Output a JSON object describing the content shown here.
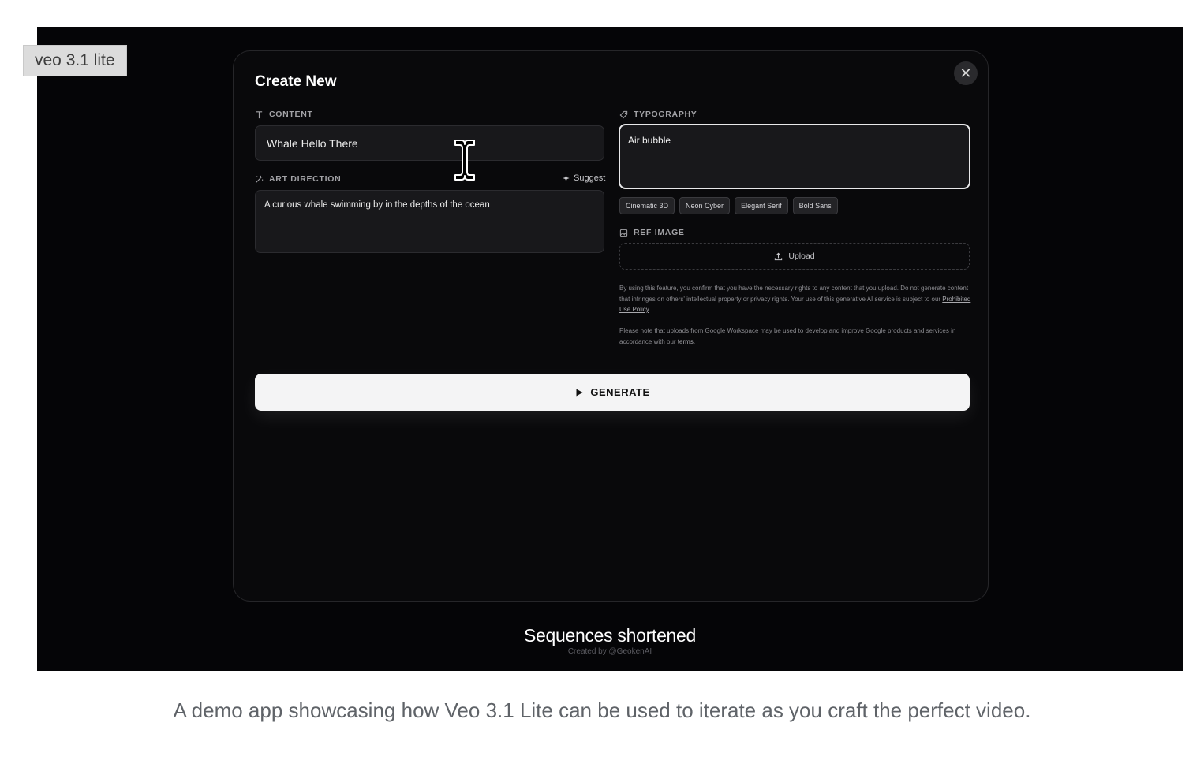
{
  "tag": "veo 3.1 lite",
  "modal": {
    "title": "Create New",
    "close_symbol": "✕",
    "content": {
      "label": "CONTENT",
      "value": "Whale Hello There"
    },
    "art_direction": {
      "label": "ART DIRECTION",
      "suggest_label": "Suggest",
      "value": "A curious whale swimming by in the depths of the ocean"
    },
    "typography": {
      "label": "TYPOGRAPHY",
      "value": "Air bubble",
      "presets": [
        "Cinematic 3D",
        "Neon Cyber",
        "Elegant Serif",
        "Bold Sans"
      ]
    },
    "ref_image": {
      "label": "REF IMAGE",
      "upload_label": "Upload"
    },
    "legal": {
      "p1_text": "By using this feature, you confirm that you have the necessary rights to any content that you upload. Do not generate content that infringes on others' intellectual property or privacy rights. Your use of this generative AI service is subject to our ",
      "p1_link": "Prohibited Use Policy",
      "p1_end": ".",
      "p2_text": "Please note that uploads from Google Workspace may be used to develop and improve Google products and services in accordance with our ",
      "p2_link": "terms",
      "p2_end": "."
    },
    "generate_label": "GENERATE"
  },
  "footer": {
    "title": "Sequences shortened",
    "subtitle": "Created by @GeokenAI"
  },
  "caption": "A demo app showcasing how Veo 3.1 Lite can be used to iterate as you craft the perfect video.",
  "colors": {
    "stage_bg": "#050507",
    "modal_bg": "#09090b",
    "button_bg": "#f4f4f5"
  }
}
